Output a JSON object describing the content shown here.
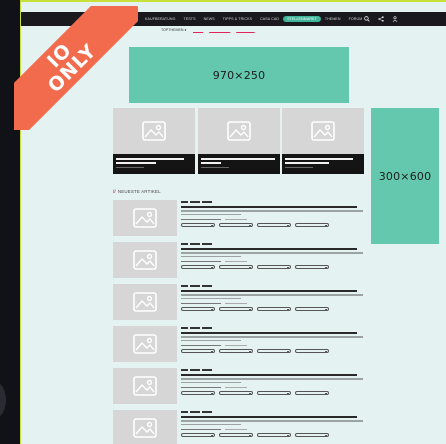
{
  "badge": {
    "line1": "IO",
    "line2": "ONLY"
  },
  "nav": {
    "links": [
      {
        "label": "KAUFBERATUNG"
      },
      {
        "label": "TESTS"
      },
      {
        "label": "NEWS"
      },
      {
        "label": "TIPPS & TRICKS"
      },
      {
        "label": "CASA CAD"
      },
      {
        "label": "STELLENMARKT",
        "active": true
      },
      {
        "label": "THEMEN"
      },
      {
        "label": "FORUM"
      }
    ]
  },
  "topthemen": {
    "label": "TOPTHEMEN"
  },
  "ads": {
    "leaderboard": "970×250",
    "halfpage": "300×600"
  },
  "section": {
    "title": "NEUESTE ARTIKEL"
  },
  "colors": {
    "accent": "#64c8ae",
    "badge": "#f26b4d",
    "frame": "#c8e03a",
    "link": "#e0245e",
    "nav_bg": "#1a1a1e"
  },
  "icons": [
    "search-icon",
    "share-icon",
    "user-icon",
    "image-placeholder-icon"
  ]
}
